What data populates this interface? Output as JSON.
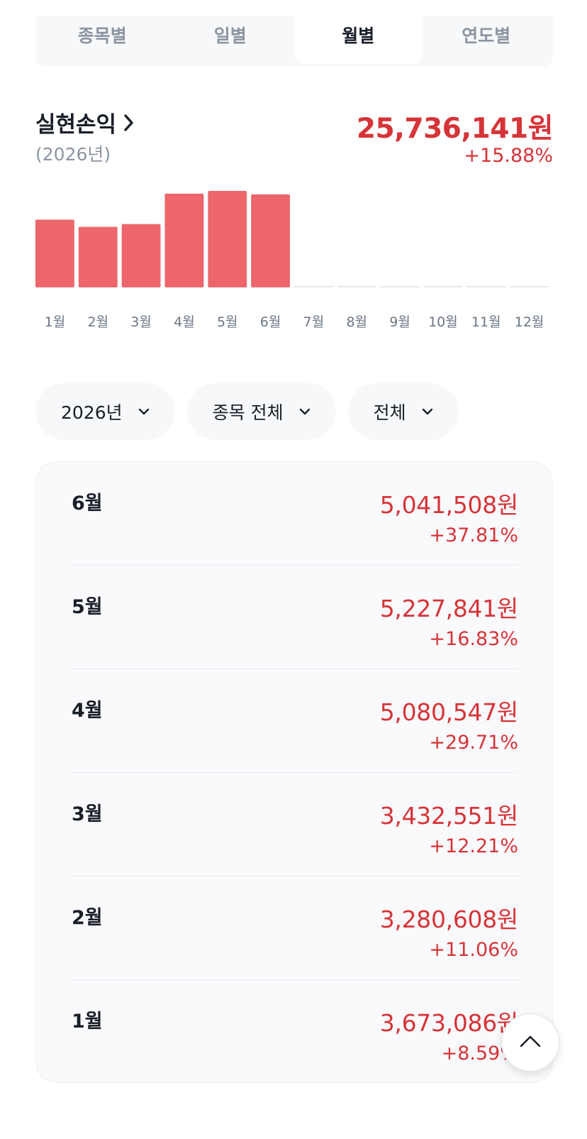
{
  "tabs": [
    {
      "label": "종목별",
      "active": false
    },
    {
      "label": "일별",
      "active": false
    },
    {
      "label": "월별",
      "active": true
    },
    {
      "label": "연도별",
      "active": false
    }
  ],
  "summary": {
    "title": "실현손익",
    "year": "(2026년)",
    "amount": "25,736,141원",
    "percent": "+15.88%"
  },
  "chart_data": {
    "type": "bar",
    "categories": [
      "1월",
      "2월",
      "3월",
      "4월",
      "5월",
      "6월",
      "7월",
      "8월",
      "9월",
      "10월",
      "11월",
      "12월"
    ],
    "values": [
      3673086,
      3280608,
      3432551,
      5080547,
      5227841,
      5041508,
      null,
      null,
      null,
      null,
      null,
      null
    ],
    "xlabel": "",
    "ylabel": "",
    "grid": false,
    "colors": {
      "bar": "#ec666c",
      "empty": "#e5e8eb"
    }
  },
  "filters": [
    {
      "label": "2026년"
    },
    {
      "label": "종목 전체"
    },
    {
      "label": "전체"
    }
  ],
  "rows": [
    {
      "month": "6월",
      "amount": "5,041,508원",
      "percent": "+37.81%"
    },
    {
      "month": "5월",
      "amount": "5,227,841원",
      "percent": "+16.83%"
    },
    {
      "month": "4월",
      "amount": "5,080,547원",
      "percent": "+29.71%"
    },
    {
      "month": "3월",
      "amount": "3,432,551원",
      "percent": "+12.21%"
    },
    {
      "month": "2월",
      "amount": "3,280,608원",
      "percent": "+11.06%"
    },
    {
      "month": "1월",
      "amount": "3,673,086원",
      "percent": "+8.59%"
    }
  ],
  "colors": {
    "profit": "#d63438",
    "text": "#191f28",
    "muted": "#8b95a1"
  },
  "icons": {
    "summary_chevron": "chevron-right-icon",
    "filter_chevron": "chevron-down-icon",
    "scroll_top": "chevron-up-icon"
  }
}
